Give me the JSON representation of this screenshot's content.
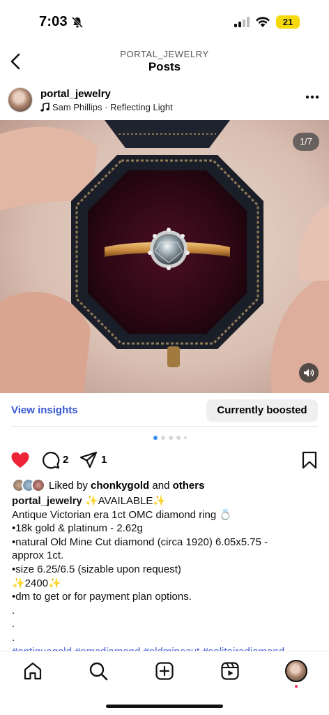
{
  "status_bar": {
    "time": "7:03",
    "battery": "21"
  },
  "header": {
    "subtitle": "PORTAL_JEWELRY",
    "title": "Posts"
  },
  "post": {
    "username": "portal_jewelry",
    "music": "Sam Phillips · Reflecting Light",
    "page_counter": "1/7",
    "insights_label": "View insights",
    "boost_label": "Currently boosted",
    "comment_count": "2",
    "share_count": "1",
    "likes_prefix": "Liked by ",
    "likes_user": "chonkygold",
    "likes_and": " and ",
    "likes_others": "others",
    "caption_user": "portal_jewelry",
    "caption_lines": [
      "✨AVAILABLE✨",
      "Antique Victorian era 1ct OMC diamond ring 💍",
      "•18k gold & platinum - 2.62g",
      "•natural Old Mine Cut diamond (circa 1920) 6.05x5.75 -",
      "approx 1ct.",
      "•size 6.25/6.5 (sizable upon request)",
      "✨2400✨",
      "•dm to get or for payment plan options.",
      ".",
      ".",
      "."
    ],
    "hashtags": "#antiquegold #omcdiamond #oldminecut #solitairediamond"
  },
  "colors": {
    "link_blue": "#3857d6",
    "like_red": "#ed2436",
    "dot_active": "#3b8ef0"
  },
  "icons": {
    "back": "chevron-left-icon",
    "more": "more-horizontal-icon",
    "like": "heart-filled-icon",
    "comment": "comment-bubble-icon",
    "share": "paper-plane-icon",
    "save": "bookmark-icon",
    "nav": [
      "home-icon",
      "search-icon",
      "create-icon",
      "reels-icon",
      "profile-avatar"
    ]
  }
}
